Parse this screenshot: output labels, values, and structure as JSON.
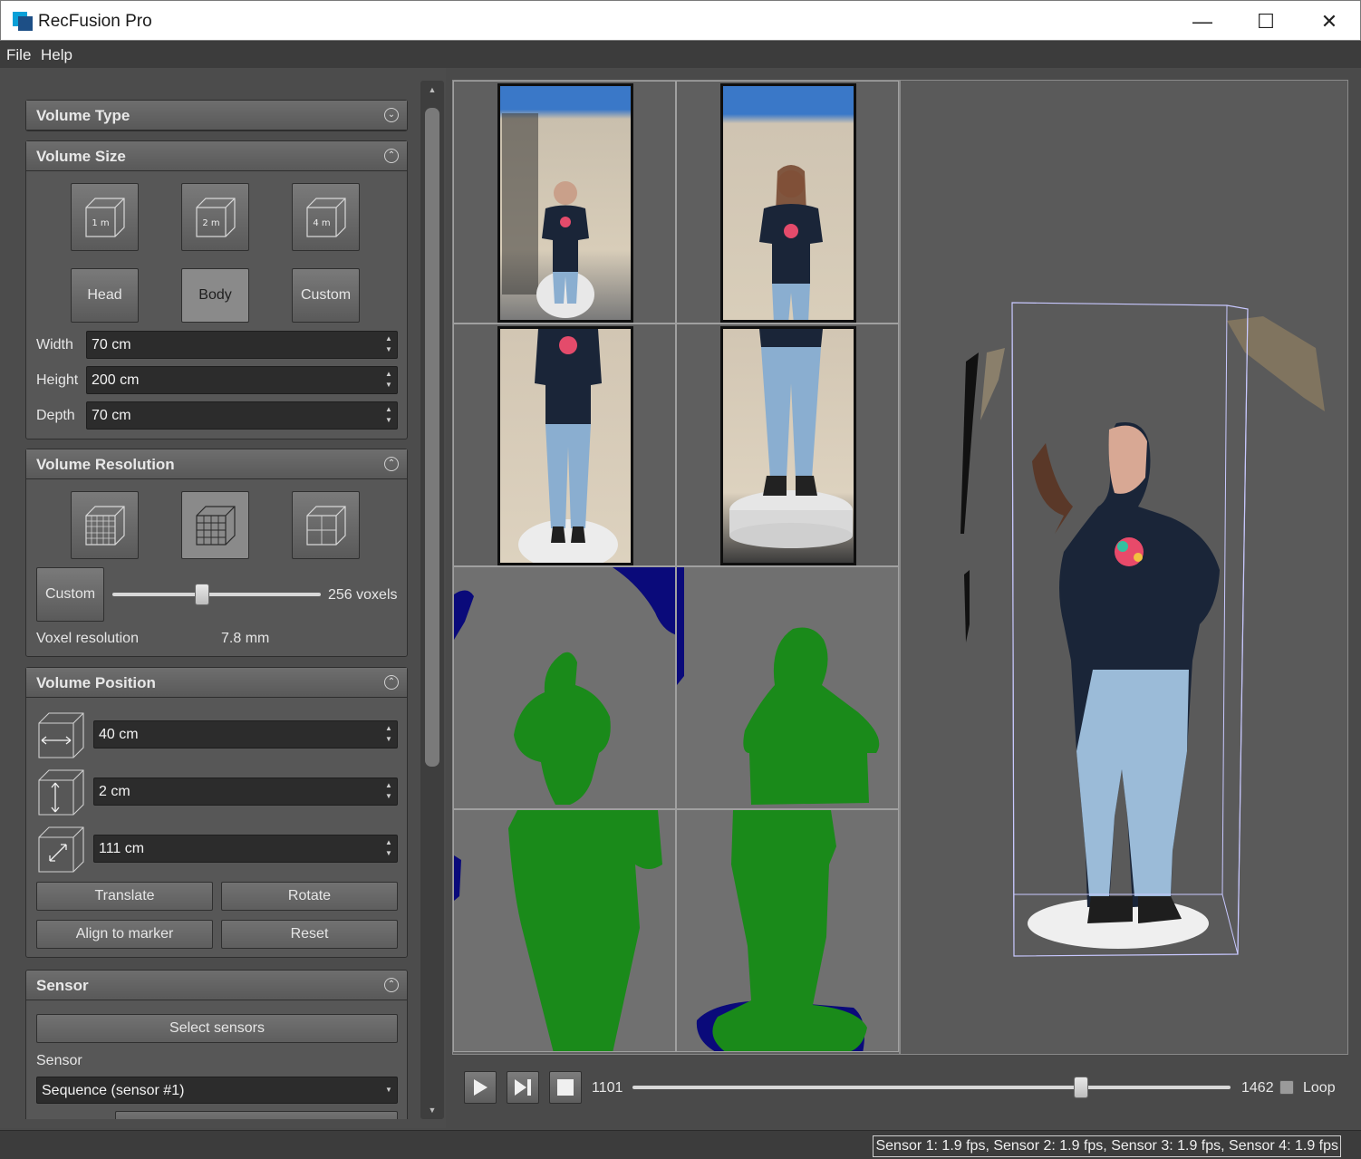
{
  "window": {
    "title": "RecFusion Pro"
  },
  "menu": {
    "file": "File",
    "help": "Help"
  },
  "groups": {
    "volume_type": {
      "title": "Volume Type"
    },
    "volume_size": {
      "title": "Volume Size",
      "cube_labels": [
        "1 m",
        "2 m",
        "4 m"
      ],
      "presets": [
        "Head",
        "Body",
        "Custom"
      ],
      "selected_preset": "Body",
      "width_label": "Width",
      "width_value": "70 cm",
      "height_label": "Height",
      "height_value": "200 cm",
      "depth_label": "Depth",
      "depth_value": "70 cm"
    },
    "volume_resolution": {
      "title": "Volume Resolution",
      "custom_label": "Custom",
      "slider_value_text": "256 voxels",
      "slider_fraction": 0.43,
      "voxel_label": "Voxel resolution",
      "voxel_value": "7.8 mm"
    },
    "volume_position": {
      "title": "Volume Position",
      "x_value": "40 cm",
      "y_value": "2 cm",
      "z_value": "111 cm",
      "translate": "Translate",
      "rotate": "Rotate",
      "align": "Align to marker",
      "reset": "Reset"
    },
    "sensor": {
      "title": "Sensor",
      "select_button": "Select sensors",
      "sensor_label": "Sensor",
      "sensor_value": "Sequence (sensor #1)"
    }
  },
  "playback": {
    "current_frame": "1101",
    "end_frame": "1462",
    "slider_fraction": 0.75,
    "loop_label": "Loop",
    "loop_checked": false
  },
  "status": {
    "text": "Sensor 1: 1.9 fps, Sensor 2: 1.9 fps, Sensor 3: 1.9 fps, Sensor 4: 1.9 fps"
  },
  "colors": {
    "depth_green": "#1a8a1a",
    "depth_blue": "#0a0a7a",
    "bbox": "#c8c8ff",
    "panel": "#575757"
  },
  "icons": {
    "app": "recfusion-logo-icon",
    "collapse": "collapse-up-icon",
    "expand": "expand-down-icon"
  }
}
